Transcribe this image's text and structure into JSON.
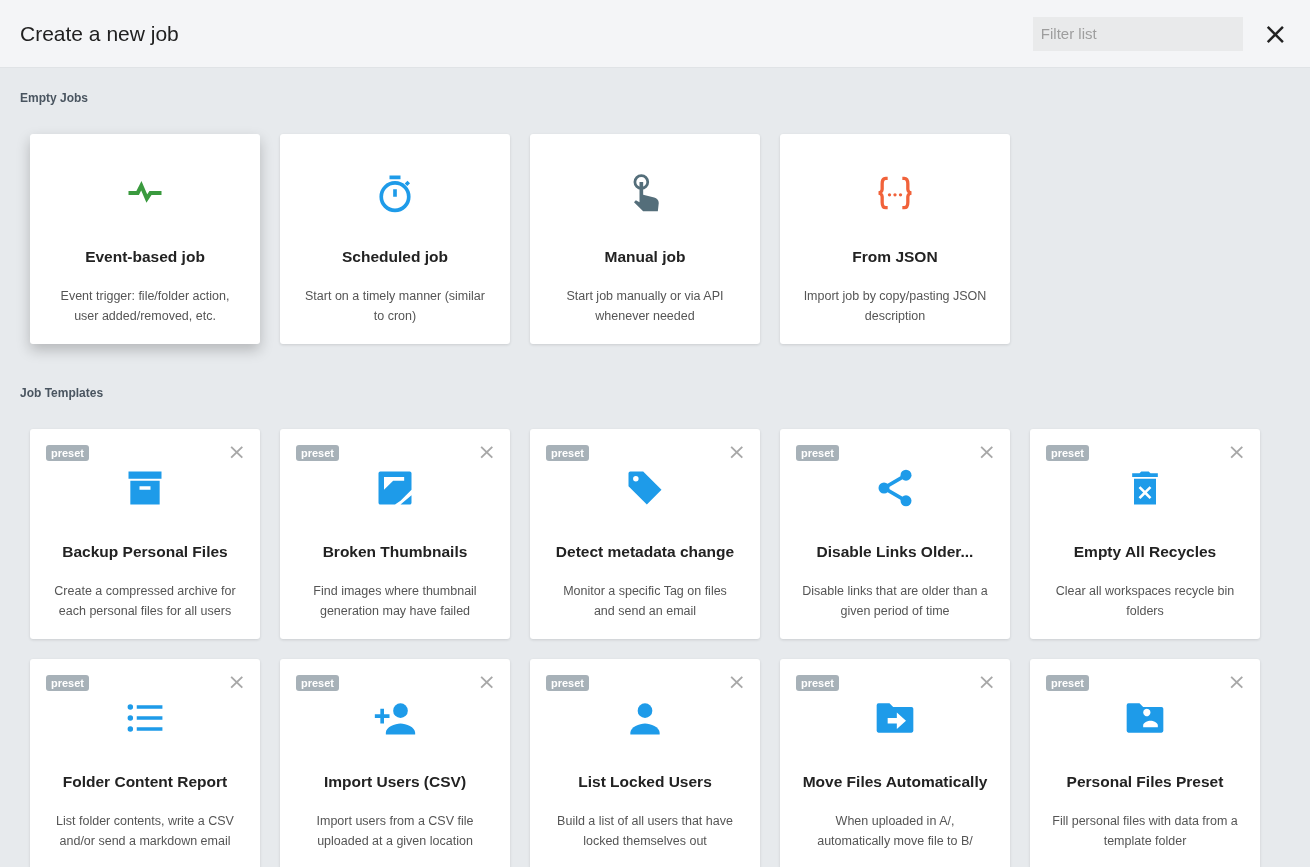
{
  "header": {
    "title": "Create a new job",
    "filter": {
      "placeholder": "Filter list"
    },
    "close": "×"
  },
  "sections": [
    {
      "title": "Empty Jobs",
      "cards": [
        {
          "kind": "pulse",
          "title": "Event-based job",
          "description": "Event trigger: file/folder action, user added/removed, etc.",
          "raised": true
        },
        {
          "kind": "timer",
          "title": "Scheduled job",
          "description": "Start on a timely manner (similar to cron)",
          "raised": false
        },
        {
          "kind": "touch",
          "title": "Manual job",
          "description": "Start job manually or via API whenever needed",
          "raised": false
        },
        {
          "kind": "braces",
          "title": "From JSON",
          "description": "Import job by copy/pasting JSON description",
          "raised": false
        }
      ]
    },
    {
      "title": "Job Templates",
      "cards": [
        {
          "kind": "archive",
          "badge": "preset",
          "title": "Backup Personal Files",
          "description": "Create a compressed archive for each personal files for all users",
          "raised": false
        },
        {
          "kind": "image",
          "badge": "preset",
          "title": "Broken Thumbnails",
          "description": "Find images where thumbnail generation may have failed",
          "raised": false
        },
        {
          "kind": "tag",
          "badge": "preset",
          "title": "Detect metadata change",
          "description": "Monitor a specific Tag on files and send an email",
          "raised": false
        },
        {
          "kind": "share",
          "badge": "preset",
          "title": "Disable Links Older...",
          "description": "Disable links that are older than a given period of time",
          "raised": false
        },
        {
          "kind": "trash",
          "badge": "preset",
          "title": "Empty All Recycles",
          "description": "Clear all workspaces recycle bin folders",
          "raised": false
        },
        {
          "kind": "list",
          "badge": "preset",
          "title": "Folder Content Report",
          "description": "List folder contents, write a CSV and/or send a markdown email",
          "raised": false
        },
        {
          "kind": "adduser",
          "badge": "preset",
          "title": "Import Users (CSV)",
          "description": "Import users from a CSV file uploaded at a given location",
          "raised": false
        },
        {
          "kind": "user",
          "badge": "preset",
          "title": "List Locked Users",
          "description": "Build a list of all users that have locked themselves out",
          "raised": false
        },
        {
          "kind": "move",
          "badge": "preset",
          "title": "Move Files Automatically",
          "description": "When uploaded in A/, automatically move file to B/",
          "raised": false
        },
        {
          "kind": "folderuser",
          "badge": "preset",
          "title": "Personal Files Preset",
          "description": "Fill personal files with data from a template folder",
          "raised": false
        }
      ]
    }
  ]
}
